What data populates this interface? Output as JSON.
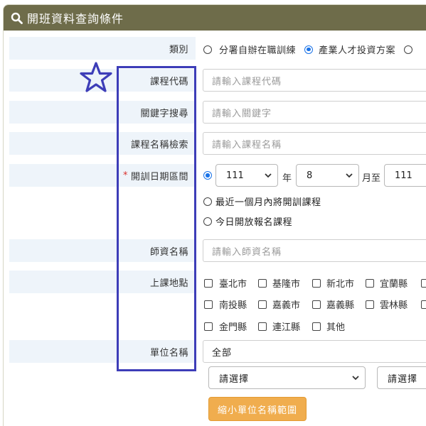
{
  "header": {
    "title": "開班資料查詢條件",
    "icon": "search-icon"
  },
  "fields": {
    "category": {
      "label": "類別",
      "options": [
        "分署自辦在職訓練",
        "產業人才投資方案",
        ""
      ],
      "selected_index": 1
    },
    "course_code": {
      "label": "課程代碼",
      "placeholder": "請輸入課程代碼"
    },
    "keyword": {
      "label": "關鍵字搜尋",
      "placeholder": "請輸入關鍵字"
    },
    "course_name": {
      "label": "課程名稱檢索",
      "placeholder": "請輸入課程名稱"
    },
    "date_range": {
      "required_mark": "*",
      "label": "開訓日期區間",
      "year_value": "111",
      "year_unit": "年",
      "month_value": "8",
      "month_until": "月至",
      "end_year_value": "111",
      "option_recent": "最近一個月內將開訓課程",
      "option_today": "今日開放報名課程"
    },
    "teacher": {
      "label": "師資名稱",
      "placeholder": "請輸入師資名稱"
    },
    "location": {
      "label": "上課地點",
      "rows": [
        [
          "臺北市",
          "基隆市",
          "新北市",
          "宜蘭縣",
          ""
        ],
        [
          "南投縣",
          "嘉義市",
          "嘉義縣",
          "雲林縣",
          ""
        ],
        [
          "金門縣",
          "連江縣",
          "其他"
        ]
      ]
    },
    "unit": {
      "label": "單位名稱",
      "value": "全部",
      "select1": "請選擇",
      "select2": "請選擇",
      "narrow_button": "縮小單位名稱範圍"
    }
  },
  "colors": {
    "header": "#6e6c4a",
    "label_bg": "#eef4fa",
    "accent": "#1a73e8",
    "highlight": "#3d3db8",
    "button": "#f0ad4e"
  }
}
